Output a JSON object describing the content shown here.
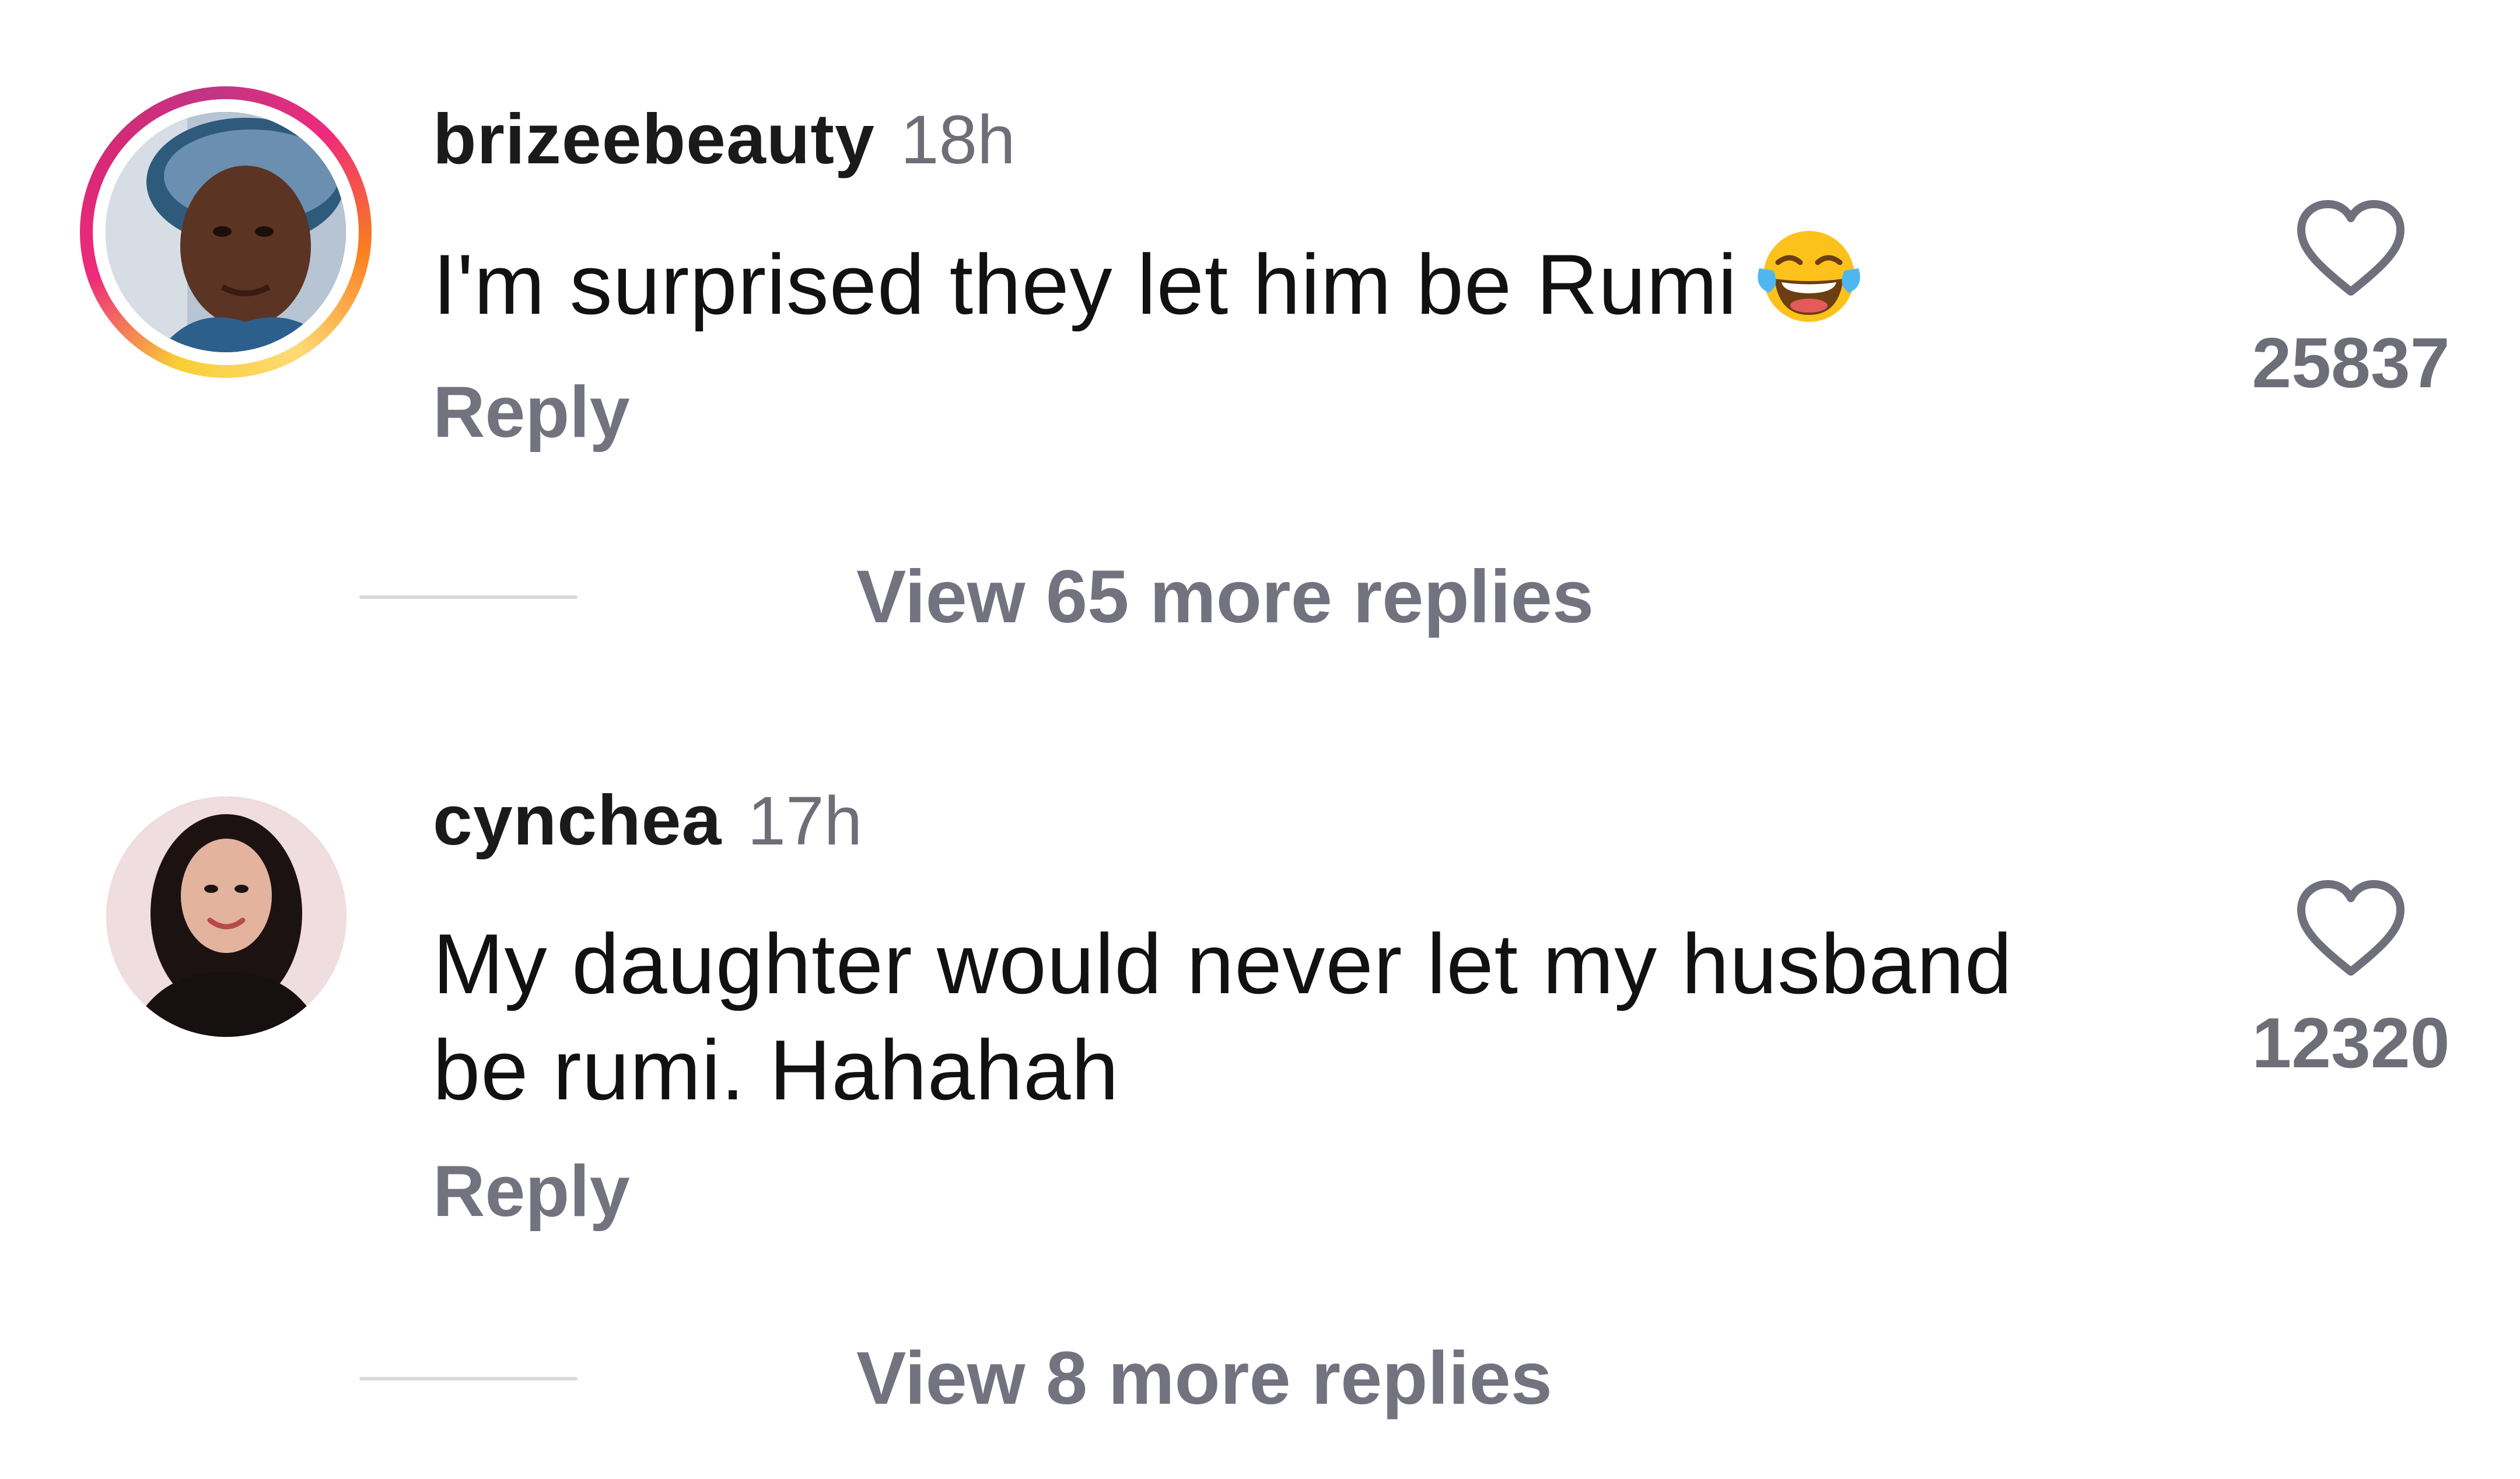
{
  "accent_colors": {
    "story_ring": [
      "#feda75",
      "#fa7e1e",
      "#d62976",
      "#962fbf"
    ],
    "secondary_text": "#737380",
    "primary_text": "#111111"
  },
  "comments": [
    {
      "username": "brizeebeauty",
      "timestamp": "18h",
      "text": "I'm surprised they let him be Rumi",
      "emoji": "face-with-tears-of-joy",
      "has_story_ring": true,
      "reply_label": "Reply",
      "like_icon": "heart-outline-icon",
      "like_count": "25837",
      "more_replies_label": "View 65 more replies"
    },
    {
      "username": "cynchea",
      "timestamp": "17h",
      "text": "My daughter would never let my husband be rumi. Hahahah",
      "has_story_ring": false,
      "reply_label": "Reply",
      "like_icon": "heart-outline-icon",
      "like_count": "12320",
      "more_replies_label": "View 8 more replies"
    }
  ]
}
